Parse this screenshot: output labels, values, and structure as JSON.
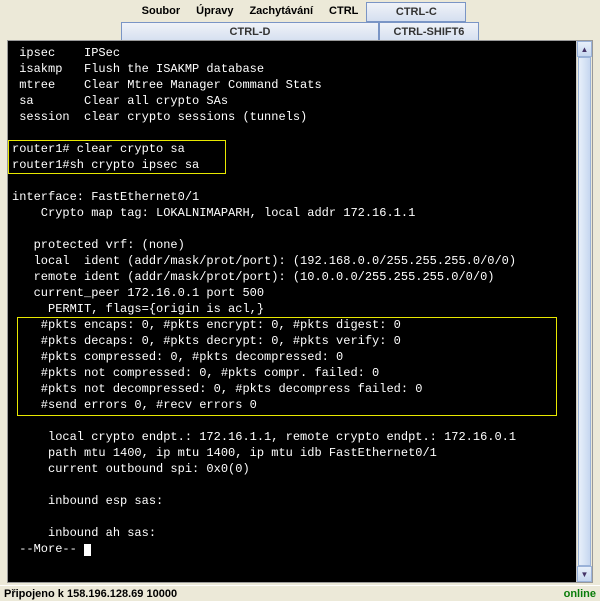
{
  "menu": {
    "soubor": "Soubor",
    "upravy": "Úpravy",
    "zachytavani": "Zachytávání",
    "ctrl": "CTRL"
  },
  "buttons": {
    "ctrlc": "CTRL-C",
    "ctrld": "CTRL-D",
    "ctrlshift6": "CTRL-SHIFT6"
  },
  "term": {
    "l1": " ipsec    IPSec",
    "l2": " isakmp   Flush the ISAKMP database",
    "l3": " mtree    Clear Mtree Manager Command Stats",
    "l4": " sa       Clear all crypto SAs",
    "l5": " session  clear crypto sessions (tunnels)",
    "l6": "",
    "l7": "router1# clear crypto sa",
    "l8": "router1#sh crypto ipsec sa",
    "l9": "",
    "l10": "interface: FastEthernet0/1",
    "l11": "    Crypto map tag: LOKALNIMAPARH, local addr 172.16.1.1",
    "l12": "",
    "l13": "   protected vrf: (none)",
    "l14": "   local  ident (addr/mask/prot/port): (192.168.0.0/255.255.255.0/0/0)",
    "l15": "   remote ident (addr/mask/prot/port): (10.0.0.0/255.255.255.0/0/0)",
    "l16": "   current_peer 172.16.0.1 port 500",
    "l17": "     PERMIT, flags={origin is acl,}",
    "l18": "    #pkts encaps: 0, #pkts encrypt: 0, #pkts digest: 0",
    "l19": "    #pkts decaps: 0, #pkts decrypt: 0, #pkts verify: 0",
    "l20": "    #pkts compressed: 0, #pkts decompressed: 0",
    "l21": "    #pkts not compressed: 0, #pkts compr. failed: 0",
    "l22": "    #pkts not decompressed: 0, #pkts decompress failed: 0",
    "l23": "    #send errors 0, #recv errors 0",
    "l24": "",
    "l25": "     local crypto endpt.: 172.16.1.1, remote crypto endpt.: 172.16.0.1",
    "l26": "     path mtu 1400, ip mtu 1400, ip mtu idb FastEthernet0/1",
    "l27": "     current outbound spi: 0x0(0)",
    "l28": "",
    "l29": "     inbound esp sas:",
    "l30": "",
    "l31": "     inbound ah sas:",
    "l32": " --More-- "
  },
  "status": {
    "left": "Připojeno k 158.196.128.69 10000",
    "right": "online"
  }
}
